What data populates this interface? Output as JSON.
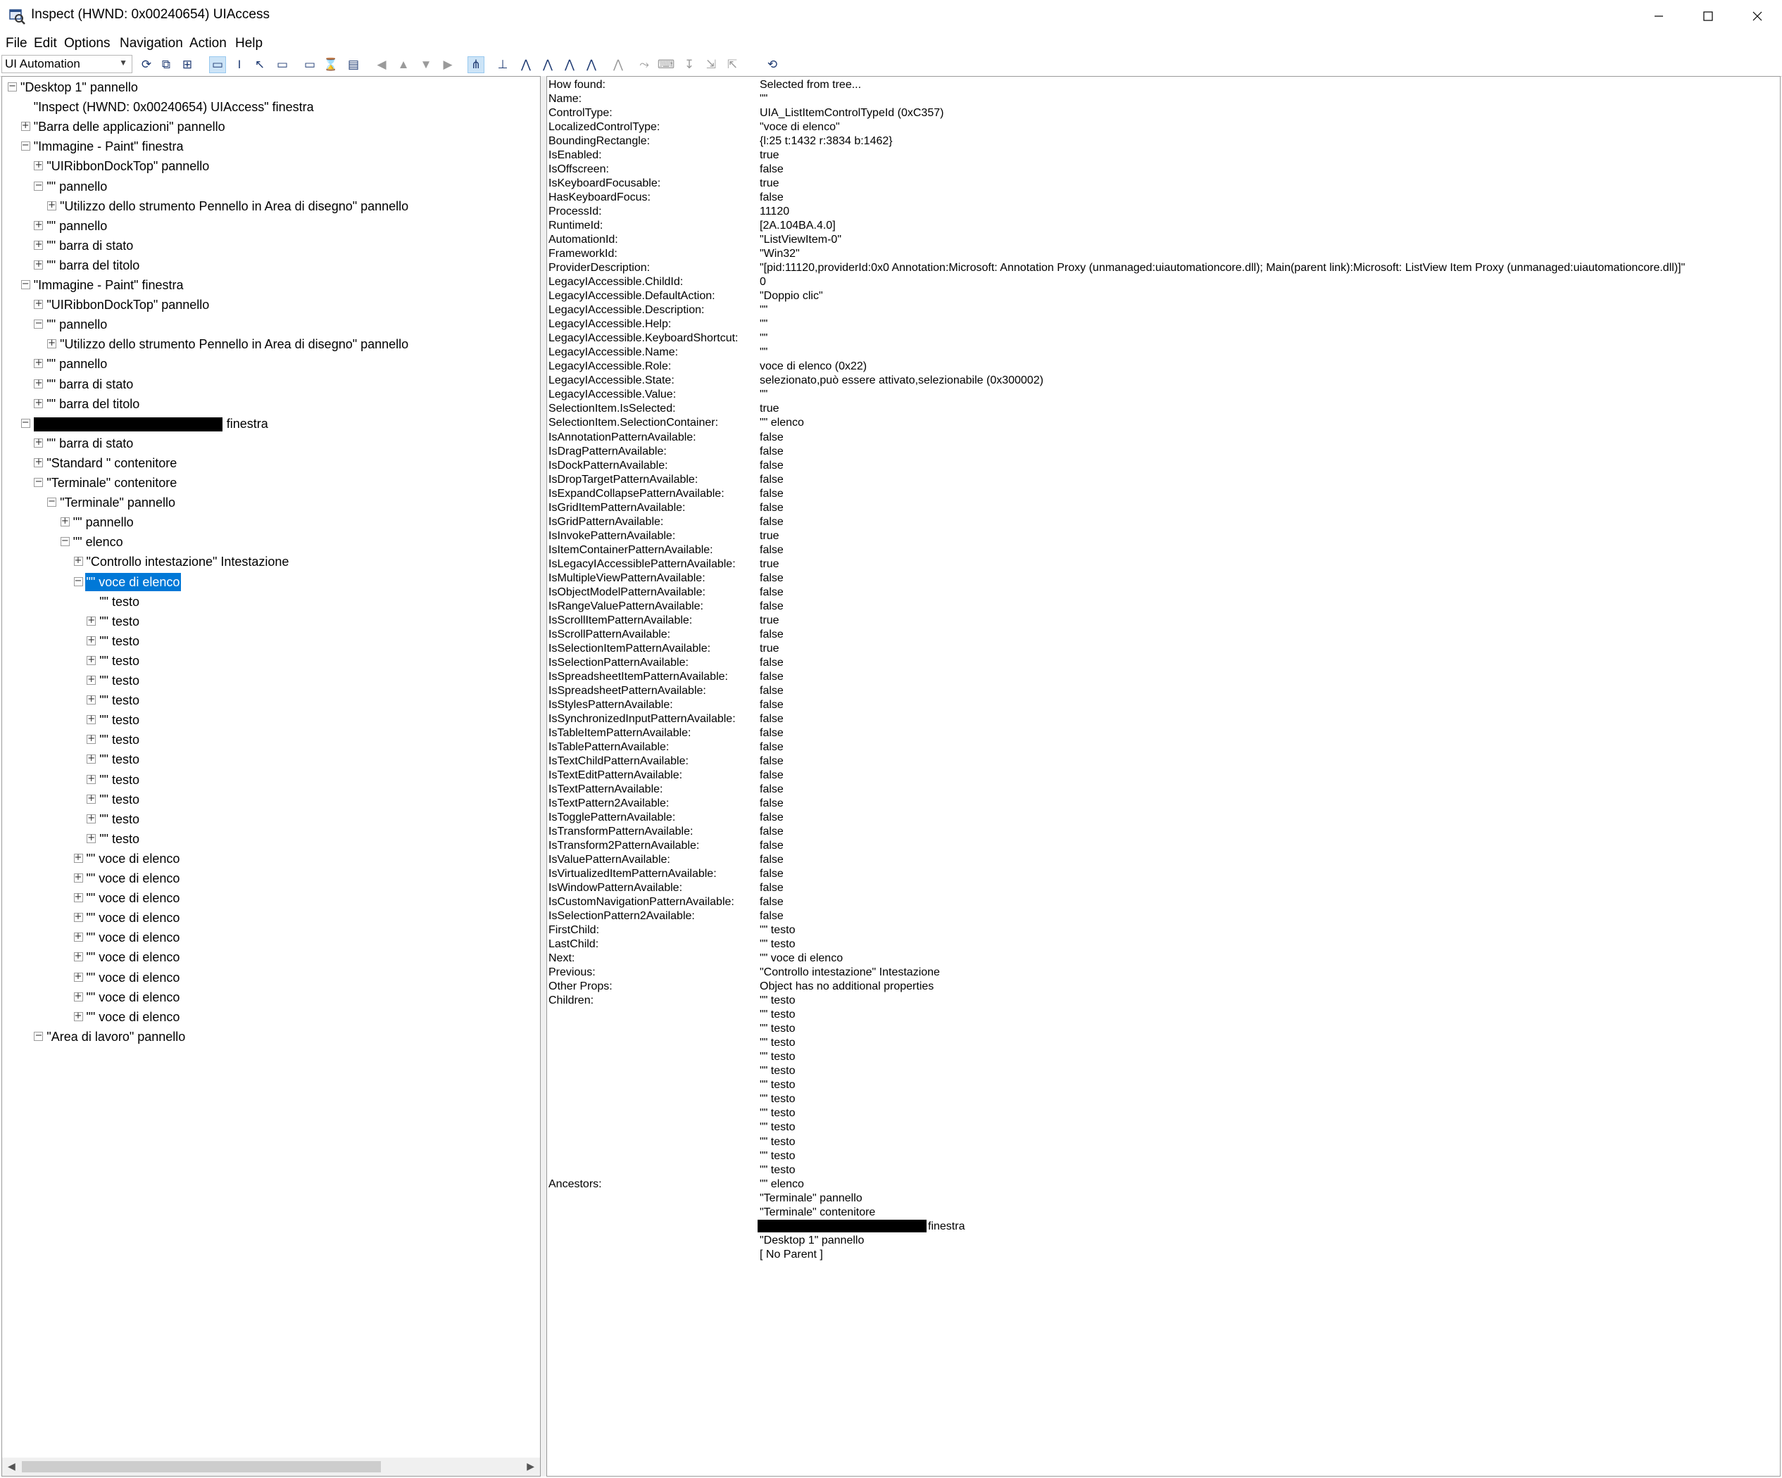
{
  "window": {
    "title": "Inspect  (HWND: 0x00240654) UIAccess",
    "minimize": "minimize",
    "maximize": "maximize",
    "close": "close"
  },
  "menu": [
    "File",
    "Edit",
    "Options",
    "Navigation",
    "Action",
    "Help"
  ],
  "toolbar": {
    "mode": "UI Automation",
    "icons": [
      "refresh-icon",
      "copy-icon",
      "copy-tree-icon",
      "watch-focus-icon",
      "watch-caret-icon",
      "watch-cursor-icon",
      "watch-tooltip-icon",
      "show-highlight-icon",
      "show-rectangle-icon",
      "show-textpattern-icon",
      "back-icon",
      "parent-icon",
      "first-child-icon",
      "next-sibling-icon",
      "tree-view-icon",
      "ancestor-icon",
      "first-icon",
      "prev-icon",
      "next-icon",
      "last-icon",
      "root-icon",
      "mouse-icon",
      "keyboard-icon",
      "focus-icon",
      "expand-icon",
      "collapse-icon",
      "refresh-tree-icon"
    ]
  },
  "tree": [
    {
      "level": 0,
      "exp": "-",
      "text": "\"Desktop 1\" pannello"
    },
    {
      "level": 1,
      "exp": "",
      "text": "\"Inspect  (HWND: 0x00240654) UIAccess\" finestra"
    },
    {
      "level": 1,
      "exp": "+",
      "text": "\"Barra delle applicazioni\" pannello"
    },
    {
      "level": 1,
      "exp": "-",
      "text": "\"Immagine - Paint\" finestra"
    },
    {
      "level": 2,
      "exp": "+",
      "text": "\"UIRibbonDockTop\" pannello"
    },
    {
      "level": 2,
      "exp": "-",
      "text": "\"\" pannello"
    },
    {
      "level": 3,
      "exp": "+",
      "text": "\"Utilizzo dello strumento Pennello in Area di disegno\" pannello"
    },
    {
      "level": 2,
      "exp": "+",
      "text": "\"\" pannello"
    },
    {
      "level": 2,
      "exp": "+",
      "text": "\"\" barra di stato"
    },
    {
      "level": 2,
      "exp": "+",
      "text": "\"\" barra del titolo"
    },
    {
      "level": 1,
      "exp": "-",
      "text": "\"Immagine - Paint\" finestra"
    },
    {
      "level": 2,
      "exp": "+",
      "text": "\"UIRibbonDockTop\" pannello"
    },
    {
      "level": 2,
      "exp": "-",
      "text": "\"\" pannello"
    },
    {
      "level": 3,
      "exp": "+",
      "text": "\"Utilizzo dello strumento Pennello in Area di disegno\" pannello"
    },
    {
      "level": 2,
      "exp": "+",
      "text": "\"\" pannello"
    },
    {
      "level": 2,
      "exp": "+",
      "text": "\"\" barra di stato"
    },
    {
      "level": 2,
      "exp": "+",
      "text": "\"\" barra del titolo"
    },
    {
      "level": 1,
      "exp": "-",
      "text": "finestra",
      "redacted": true
    },
    {
      "level": 2,
      "exp": "+",
      "text": "\"\" barra di stato"
    },
    {
      "level": 2,
      "exp": "+",
      "text": "\"Standard \" contenitore"
    },
    {
      "level": 2,
      "exp": "-",
      "text": "\"Terminale\" contenitore"
    },
    {
      "level": 3,
      "exp": "-",
      "text": "\"Terminale\" pannello"
    },
    {
      "level": 4,
      "exp": "+",
      "text": "\"\" pannello"
    },
    {
      "level": 4,
      "exp": "-",
      "text": "\"\" elenco"
    },
    {
      "level": 5,
      "exp": "+",
      "text": "\"Controllo intestazione\" Intestazione"
    },
    {
      "level": 5,
      "exp": "-",
      "text": "\"\" voce di elenco",
      "selected": true
    },
    {
      "level": 6,
      "exp": "",
      "text": "\"\" testo"
    },
    {
      "level": 6,
      "exp": "+",
      "text": "\"\" testo"
    },
    {
      "level": 6,
      "exp": "+",
      "text": "\"\" testo"
    },
    {
      "level": 6,
      "exp": "+",
      "text": "\"\" testo"
    },
    {
      "level": 6,
      "exp": "+",
      "text": "\"\" testo"
    },
    {
      "level": 6,
      "exp": "+",
      "text": "\"\" testo"
    },
    {
      "level": 6,
      "exp": "+",
      "text": "\"\" testo"
    },
    {
      "level": 6,
      "exp": "+",
      "text": "\"\" testo"
    },
    {
      "level": 6,
      "exp": "+",
      "text": "\"\" testo"
    },
    {
      "level": 6,
      "exp": "+",
      "text": "\"\" testo"
    },
    {
      "level": 6,
      "exp": "+",
      "text": "\"\" testo"
    },
    {
      "level": 6,
      "exp": "+",
      "text": "\"\" testo"
    },
    {
      "level": 6,
      "exp": "+",
      "text": "\"\" testo"
    },
    {
      "level": 5,
      "exp": "+",
      "text": "\"\" voce di elenco"
    },
    {
      "level": 5,
      "exp": "+",
      "text": "\"\" voce di elenco"
    },
    {
      "level": 5,
      "exp": "+",
      "text": "\"\" voce di elenco"
    },
    {
      "level": 5,
      "exp": "+",
      "text": "\"\" voce di elenco"
    },
    {
      "level": 5,
      "exp": "+",
      "text": "\"\" voce di elenco"
    },
    {
      "level": 5,
      "exp": "+",
      "text": "\"\" voce di elenco"
    },
    {
      "level": 5,
      "exp": "+",
      "text": "\"\" voce di elenco"
    },
    {
      "level": 5,
      "exp": "+",
      "text": "\"\" voce di elenco"
    },
    {
      "level": 5,
      "exp": "+",
      "text": "\"\" voce di elenco"
    },
    {
      "level": 2,
      "exp": "-",
      "text": "\"Area di lavoro\" pannello"
    }
  ],
  "properties": [
    {
      "k": "How found:",
      "v": "Selected from tree..."
    },
    {
      "k": "Name:",
      "v": "\"\""
    },
    {
      "k": "ControlType:",
      "v": "UIA_ListItemControlTypeId (0xC357)"
    },
    {
      "k": "LocalizedControlType:",
      "v": "\"voce di elenco\""
    },
    {
      "k": "BoundingRectangle:",
      "v": "{l:25 t:1432 r:3834 b:1462}"
    },
    {
      "k": "IsEnabled:",
      "v": "true"
    },
    {
      "k": "IsOffscreen:",
      "v": "false"
    },
    {
      "k": "IsKeyboardFocusable:",
      "v": "true"
    },
    {
      "k": "HasKeyboardFocus:",
      "v": "false"
    },
    {
      "k": "ProcessId:",
      "v": "11120"
    },
    {
      "k": "RuntimeId:",
      "v": "[2A.104BA.4.0]"
    },
    {
      "k": "AutomationId:",
      "v": "\"ListViewItem-0\""
    },
    {
      "k": "FrameworkId:",
      "v": "\"Win32\""
    },
    {
      "k": "ProviderDescription:",
      "v": "\"[pid:11120,providerId:0x0 Annotation:Microsoft: Annotation Proxy (unmanaged:uiautomationcore.dll); Main(parent link):Microsoft: ListView Item Proxy (unmanaged:uiautomationcore.dll)]\""
    },
    {
      "k": "LegacyIAccessible.ChildId:",
      "v": "0"
    },
    {
      "k": "LegacyIAccessible.DefaultAction:",
      "v": "\"Doppio clic\""
    },
    {
      "k": "LegacyIAccessible.Description:",
      "v": "\"\""
    },
    {
      "k": "LegacyIAccessible.Help:",
      "v": "\"\""
    },
    {
      "k": "LegacyIAccessible.KeyboardShortcut:",
      "v": "\"\""
    },
    {
      "k": "LegacyIAccessible.Name:",
      "v": "\"\""
    },
    {
      "k": "LegacyIAccessible.Role:",
      "v": "voce di elenco (0x22)"
    },
    {
      "k": "LegacyIAccessible.State:",
      "v": "selezionato,può essere attivato,selezionabile (0x300002)"
    },
    {
      "k": "LegacyIAccessible.Value:",
      "v": "\"\""
    },
    {
      "k": "SelectionItem.IsSelected:",
      "v": "true"
    },
    {
      "k": "SelectionItem.SelectionContainer:",
      "v": "\"\" elenco"
    },
    {
      "k": "IsAnnotationPatternAvailable:",
      "v": "false"
    },
    {
      "k": "IsDragPatternAvailable:",
      "v": "false"
    },
    {
      "k": "IsDockPatternAvailable:",
      "v": "false"
    },
    {
      "k": "IsDropTargetPatternAvailable:",
      "v": "false"
    },
    {
      "k": "IsExpandCollapsePatternAvailable:",
      "v": "false"
    },
    {
      "k": "IsGridItemPatternAvailable:",
      "v": "false"
    },
    {
      "k": "IsGridPatternAvailable:",
      "v": "false"
    },
    {
      "k": "IsInvokePatternAvailable:",
      "v": "true"
    },
    {
      "k": "IsItemContainerPatternAvailable:",
      "v": "false"
    },
    {
      "k": "IsLegacyIAccessiblePatternAvailable:",
      "v": "true"
    },
    {
      "k": "IsMultipleViewPatternAvailable:",
      "v": "false"
    },
    {
      "k": "IsObjectModelPatternAvailable:",
      "v": "false"
    },
    {
      "k": "IsRangeValuePatternAvailable:",
      "v": "false"
    },
    {
      "k": "IsScrollItemPatternAvailable:",
      "v": "true"
    },
    {
      "k": "IsScrollPatternAvailable:",
      "v": "false"
    },
    {
      "k": "IsSelectionItemPatternAvailable:",
      "v": "true"
    },
    {
      "k": "IsSelectionPatternAvailable:",
      "v": "false"
    },
    {
      "k": "IsSpreadsheetItemPatternAvailable:",
      "v": "false"
    },
    {
      "k": "IsSpreadsheetPatternAvailable:",
      "v": "false"
    },
    {
      "k": "IsStylesPatternAvailable:",
      "v": "false"
    },
    {
      "k": "IsSynchronizedInputPatternAvailable:",
      "v": "false"
    },
    {
      "k": "IsTableItemPatternAvailable:",
      "v": "false"
    },
    {
      "k": "IsTablePatternAvailable:",
      "v": "false"
    },
    {
      "k": "IsTextChildPatternAvailable:",
      "v": "false"
    },
    {
      "k": "IsTextEditPatternAvailable:",
      "v": "false"
    },
    {
      "k": "IsTextPatternAvailable:",
      "v": "false"
    },
    {
      "k": "IsTextPattern2Available:",
      "v": "false"
    },
    {
      "k": "IsTogglePatternAvailable:",
      "v": "false"
    },
    {
      "k": "IsTransformPatternAvailable:",
      "v": "false"
    },
    {
      "k": "IsTransform2PatternAvailable:",
      "v": "false"
    },
    {
      "k": "IsValuePatternAvailable:",
      "v": "false"
    },
    {
      "k": "IsVirtualizedItemPatternAvailable:",
      "v": "false"
    },
    {
      "k": "IsWindowPatternAvailable:",
      "v": "false"
    },
    {
      "k": "IsCustomNavigationPatternAvailable:",
      "v": "false"
    },
    {
      "k": "IsSelectionPattern2Available:",
      "v": "false"
    },
    {
      "k": "FirstChild:",
      "v": "\"\" testo"
    },
    {
      "k": "LastChild:",
      "v": "\"\" testo"
    },
    {
      "k": "Next:",
      "v": "\"\" voce di elenco"
    },
    {
      "k": "Previous:",
      "v": "\"Controllo intestazione\" Intestazione"
    },
    {
      "k": "Other Props:",
      "v": "Object has no additional properties"
    },
    {
      "k": "Children:",
      "v": "\"\" testo"
    },
    {
      "k": "",
      "v": "\"\" testo"
    },
    {
      "k": "",
      "v": "\"\" testo"
    },
    {
      "k": "",
      "v": "\"\" testo"
    },
    {
      "k": "",
      "v": "\"\" testo"
    },
    {
      "k": "",
      "v": "\"\" testo"
    },
    {
      "k": "",
      "v": "\"\" testo"
    },
    {
      "k": "",
      "v": "\"\" testo"
    },
    {
      "k": "",
      "v": "\"\" testo"
    },
    {
      "k": "",
      "v": "\"\" testo"
    },
    {
      "k": "",
      "v": "\"\" testo"
    },
    {
      "k": "",
      "v": "\"\" testo"
    },
    {
      "k": "",
      "v": "\"\" testo"
    },
    {
      "k": "Ancestors:",
      "v": "\"\" elenco"
    },
    {
      "k": "",
      "v": "\"Terminale\" pannello"
    },
    {
      "k": "",
      "v": "\"Terminale\" contenitore"
    },
    {
      "k": "",
      "v": "finestra",
      "redacted": true
    },
    {
      "k": "",
      "v": "\"Desktop 1\" pannello"
    },
    {
      "k": "",
      "v": "[ No Parent ]"
    }
  ]
}
